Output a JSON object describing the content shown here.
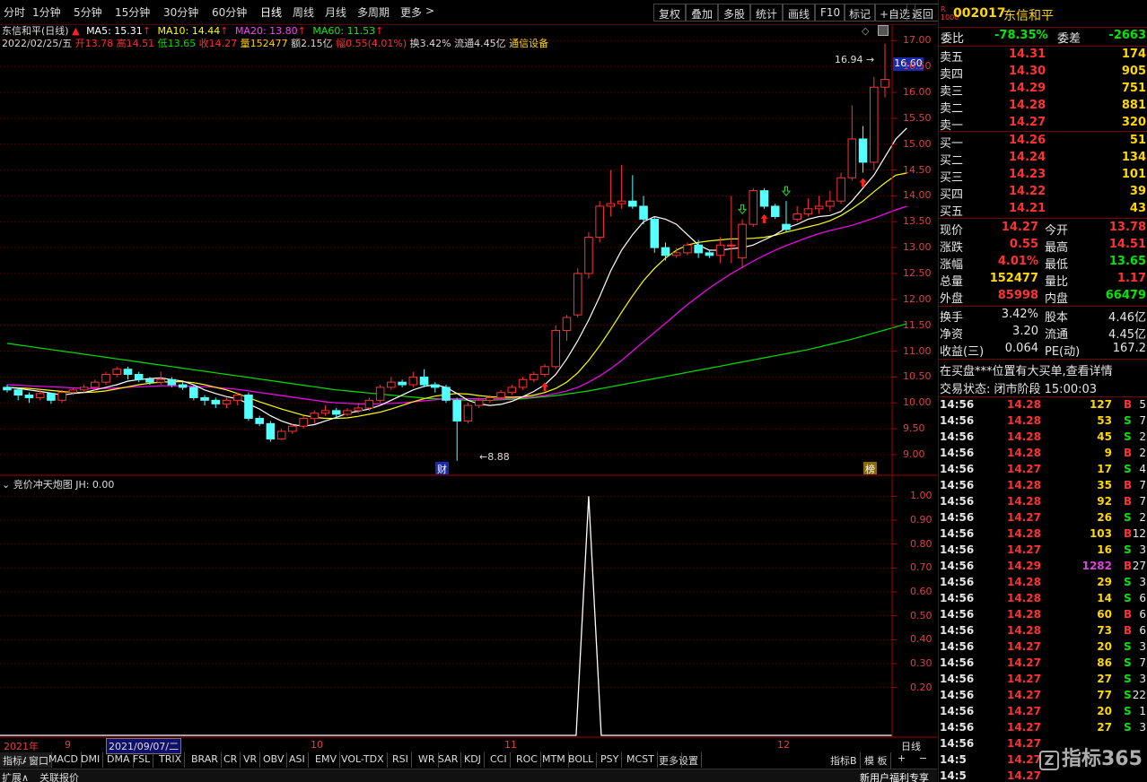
{
  "toolbar": {
    "periods": [
      "分时",
      "1分钟",
      "5分钟",
      "15分钟",
      "30分钟",
      "60分钟",
      "日线",
      "周线",
      "月线",
      "多周期",
      "更多"
    ],
    "buttons": [
      "复权",
      "叠加",
      "多股",
      "统计",
      "画线",
      "F10",
      "标记",
      "+自选",
      "返回"
    ]
  },
  "info": {
    "title": "东信和平(日线)",
    "ma5": "MA5: 15.31",
    "ma10": "MA10: 14.44",
    "ma20": "MA20: 13.80",
    "ma60": "MA60: 11.53",
    "date": "2022/02/25/五",
    "open": "开13.78",
    "high": "高14.51",
    "low": "低13.65",
    "close": "收14.27",
    "volume": "量152477",
    "amount": "额2.15亿",
    "amp": "幅0.55(4.01%)",
    "turnover": "换3.42%",
    "float": "流通4.45亿",
    "industry": "通信设备"
  },
  "chart_data": {
    "type": "candlestick",
    "ylim": [
      8.6,
      17.3
    ],
    "y_ticks": [
      "17.00",
      "16.50",
      "16.00",
      "15.50",
      "15.00",
      "14.50",
      "14.00",
      "13.50",
      "13.00",
      "12.50",
      "12.00",
      "11.50",
      "11.00",
      "10.50",
      "10.00",
      "9.50",
      "9.00"
    ],
    "y_values": [
      17,
      16.5,
      16,
      15.5,
      15,
      14.5,
      14,
      13.5,
      13,
      12.5,
      12,
      11.5,
      11,
      10.5,
      10,
      9.5,
      9
    ],
    "current_price": "16.60",
    "high_label": "16.94",
    "low_label": "8.88",
    "marker_cai": "财",
    "marker_bang": "榜",
    "candles": [
      [
        10.3,
        10.25,
        10.35,
        10.2
      ],
      [
        10.25,
        10.15,
        10.3,
        10.05
      ],
      [
        10.15,
        10.1,
        10.2,
        10.0
      ],
      [
        10.1,
        10.18,
        10.25,
        10.05
      ],
      [
        10.18,
        10.05,
        10.2,
        9.98
      ],
      [
        10.05,
        10.2,
        10.25,
        10.0
      ],
      [
        10.2,
        10.25,
        10.3,
        10.15
      ],
      [
        10.25,
        10.3,
        10.35,
        10.2
      ],
      [
        10.3,
        10.4,
        10.45,
        10.25
      ],
      [
        10.4,
        10.55,
        10.6,
        10.35
      ],
      [
        10.55,
        10.65,
        10.7,
        10.5
      ],
      [
        10.65,
        10.55,
        10.7,
        10.45
      ],
      [
        10.55,
        10.45,
        10.6,
        10.4
      ],
      [
        10.45,
        10.4,
        10.5,
        10.35
      ],
      [
        10.4,
        10.45,
        10.6,
        10.35
      ],
      [
        10.45,
        10.35,
        10.5,
        10.3
      ],
      [
        10.35,
        10.3,
        10.4,
        10.25
      ],
      [
        10.3,
        10.1,
        10.35,
        10.05
      ],
      [
        10.1,
        10.05,
        10.15,
        9.95
      ],
      [
        10.05,
        9.98,
        10.1,
        9.9
      ],
      [
        9.98,
        10.05,
        10.1,
        9.9
      ],
      [
        10.05,
        10.15,
        10.2,
        9.95
      ],
      [
        10.15,
        9.7,
        10.2,
        9.65
      ],
      [
        9.7,
        9.6,
        9.75,
        9.55
      ],
      [
        9.6,
        9.3,
        9.65,
        9.25
      ],
      [
        9.3,
        9.45,
        9.5,
        9.28
      ],
      [
        9.45,
        9.55,
        9.6,
        9.4
      ],
      [
        9.55,
        9.7,
        9.75,
        9.5
      ],
      [
        9.7,
        9.8,
        9.85,
        9.6
      ],
      [
        9.8,
        9.85,
        9.95,
        9.75
      ],
      [
        9.85,
        9.78,
        9.9,
        9.7
      ],
      [
        9.78,
        9.85,
        9.9,
        9.75
      ],
      [
        9.85,
        9.9,
        10.0,
        9.8
      ],
      [
        9.9,
        10.05,
        10.1,
        9.85
      ],
      [
        10.05,
        10.3,
        10.35,
        10.0
      ],
      [
        10.3,
        10.4,
        10.5,
        10.25
      ],
      [
        10.4,
        10.35,
        10.45,
        10.3
      ],
      [
        10.35,
        10.5,
        10.6,
        10.3
      ],
      [
        10.5,
        10.35,
        10.65,
        10.3
      ],
      [
        10.35,
        10.3,
        10.4,
        10.2
      ],
      [
        10.3,
        10.05,
        10.35,
        10.0
      ],
      [
        10.05,
        9.65,
        10.1,
        8.88
      ],
      [
        9.65,
        9.95,
        10.0,
        9.6
      ],
      [
        9.95,
        10.05,
        10.1,
        9.9
      ],
      [
        10.05,
        10.1,
        10.15,
        10.0
      ],
      [
        10.1,
        10.2,
        10.25,
        10.05
      ],
      [
        10.2,
        10.3,
        10.35,
        10.15
      ],
      [
        10.3,
        10.45,
        10.5,
        10.25
      ],
      [
        10.45,
        10.55,
        10.6,
        10.4
      ],
      [
        10.55,
        10.7,
        10.75,
        10.5
      ],
      [
        10.7,
        11.4,
        11.5,
        10.65
      ],
      [
        11.4,
        11.65,
        11.7,
        11.2
      ],
      [
        11.7,
        12.5,
        12.6,
        11.65
      ],
      [
        12.5,
        13.2,
        13.3,
        12.4
      ],
      [
        13.2,
        13.8,
        13.9,
        13.1
      ],
      [
        13.8,
        13.85,
        14.5,
        13.6
      ],
      [
        13.85,
        13.9,
        14.6,
        13.75
      ],
      [
        13.9,
        13.8,
        14.4,
        13.75
      ],
      [
        13.8,
        13.55,
        14.0,
        13.45
      ],
      [
        13.55,
        13.0,
        13.6,
        12.9
      ],
      [
        13.0,
        12.85,
        13.1,
        12.75
      ],
      [
        12.85,
        12.9,
        13.0,
        12.8
      ],
      [
        12.9,
        13.05,
        13.1,
        12.85
      ],
      [
        13.05,
        12.9,
        13.15,
        12.8
      ],
      [
        12.9,
        12.85,
        12.95,
        12.8
      ],
      [
        12.85,
        13.05,
        13.2,
        12.7
      ],
      [
        13.05,
        13.05,
        14.0,
        12.7
      ],
      [
        12.8,
        13.45,
        13.55,
        12.6
      ],
      [
        13.45,
        14.1,
        14.15,
        13.4
      ],
      [
        14.1,
        13.8,
        14.15,
        13.75
      ],
      [
        13.8,
        13.6,
        13.85,
        13.55
      ],
      [
        13.45,
        13.35,
        13.9,
        13.3
      ],
      [
        13.55,
        13.65,
        13.8,
        13.5
      ],
      [
        13.65,
        13.75,
        13.95,
        13.6
      ],
      [
        13.75,
        13.8,
        14.0,
        13.65
      ],
      [
        13.8,
        13.9,
        14.1,
        13.7
      ],
      [
        13.9,
        14.35,
        14.45,
        13.85
      ],
      [
        14.35,
        15.1,
        15.75,
        14.3
      ],
      [
        15.1,
        14.65,
        15.35,
        14.45
      ],
      [
        14.65,
        16.1,
        16.3,
        14.5
      ],
      [
        16.1,
        16.25,
        16.94,
        15.9
      ]
    ],
    "ma5": [
      10.3,
      10.28,
      10.25,
      10.22,
      10.19,
      10.15,
      10.18,
      10.2,
      10.25,
      10.3,
      10.35,
      10.42,
      10.45,
      10.47,
      10.48,
      10.45,
      10.42,
      10.35,
      10.25,
      10.18,
      10.12,
      10.08,
      9.98,
      9.88,
      9.75,
      9.65,
      9.58,
      9.55,
      9.58,
      9.65,
      9.72,
      9.8,
      9.84,
      9.88,
      9.95,
      10.05,
      10.15,
      10.25,
      10.32,
      10.35,
      10.3,
      10.18,
      10.05,
      9.98,
      9.95,
      9.97,
      10.03,
      10.12,
      10.22,
      10.35,
      10.55,
      10.85,
      11.2,
      11.6,
      12.05,
      12.55,
      12.95,
      13.25,
      13.5,
      13.6,
      13.55,
      13.45,
      13.25,
      13.05,
      12.95,
      12.95,
      12.98,
      13.0,
      13.05,
      13.15,
      13.25,
      13.38,
      13.45,
      13.55,
      13.6,
      13.62,
      13.7,
      13.9,
      14.15,
      14.4,
      14.75,
      15.1,
      15.31
    ],
    "ma10": [
      10.3,
      10.29,
      10.28,
      10.26,
      10.24,
      10.22,
      10.2,
      10.2,
      10.21,
      10.23,
      10.27,
      10.31,
      10.35,
      10.38,
      10.4,
      10.41,
      10.41,
      10.39,
      10.35,
      10.3,
      10.25,
      10.18,
      10.1,
      10.02,
      9.95,
      9.88,
      9.82,
      9.76,
      9.72,
      9.7,
      9.7,
      9.71,
      9.74,
      9.78,
      9.82,
      9.88,
      9.95,
      10.02,
      10.08,
      10.13,
      10.16,
      10.18,
      10.17,
      10.14,
      10.12,
      10.11,
      10.11,
      10.12,
      10.15,
      10.2,
      10.28,
      10.4,
      10.58,
      10.82,
      11.1,
      11.42,
      11.75,
      12.07,
      12.36,
      12.6,
      12.8,
      12.95,
      13.05,
      13.1,
      13.13,
      13.15,
      13.17,
      13.17,
      13.18,
      13.2,
      13.24,
      13.3,
      13.35,
      13.4,
      13.45,
      13.52,
      13.62,
      13.75,
      13.9,
      14.08,
      14.25,
      14.4,
      14.44
    ],
    "ma20": [
      10.35,
      10.34,
      10.33,
      10.32,
      10.31,
      10.3,
      10.29,
      10.28,
      10.28,
      10.28,
      10.29,
      10.3,
      10.31,
      10.32,
      10.33,
      10.33,
      10.33,
      10.32,
      10.31,
      10.3,
      10.28,
      10.26,
      10.23,
      10.2,
      10.17,
      10.14,
      10.11,
      10.08,
      10.05,
      10.02,
      10.0,
      9.99,
      9.98,
      9.98,
      9.98,
      9.99,
      10.0,
      10.02,
      10.04,
      10.06,
      10.08,
      10.08,
      10.08,
      10.08,
      10.08,
      10.08,
      10.09,
      10.1,
      10.12,
      10.14,
      10.18,
      10.23,
      10.3,
      10.4,
      10.52,
      10.66,
      10.82,
      11.0,
      11.18,
      11.36,
      11.54,
      11.72,
      11.9,
      12.06,
      12.22,
      12.36,
      12.5,
      12.62,
      12.74,
      12.85,
      12.95,
      13.04,
      13.12,
      13.2,
      13.27,
      13.33,
      13.38,
      13.43,
      13.5,
      13.57,
      13.65,
      13.73,
      13.8
    ],
    "ma60": [
      11.15,
      11.12,
      11.09,
      11.06,
      11.03,
      11.0,
      10.97,
      10.94,
      10.91,
      10.88,
      10.85,
      10.82,
      10.79,
      10.76,
      10.73,
      10.7,
      10.67,
      10.64,
      10.61,
      10.58,
      10.55,
      10.52,
      10.49,
      10.46,
      10.43,
      10.4,
      10.37,
      10.34,
      10.31,
      10.28,
      10.25,
      10.23,
      10.21,
      10.19,
      10.17,
      10.15,
      10.13,
      10.11,
      10.09,
      10.08,
      10.07,
      10.06,
      10.05,
      10.05,
      10.05,
      10.06,
      10.07,
      10.08,
      10.1,
      10.12,
      10.14,
      10.17,
      10.2,
      10.23,
      10.27,
      10.31,
      10.35,
      10.39,
      10.43,
      10.47,
      10.51,
      10.55,
      10.59,
      10.63,
      10.67,
      10.71,
      10.75,
      10.79,
      10.83,
      10.87,
      10.91,
      10.95,
      10.99,
      11.03,
      11.08,
      11.13,
      11.18,
      11.23,
      11.29,
      11.35,
      11.41,
      11.47,
      11.53
    ],
    "colors": {
      "up": "#ff3232",
      "down": "#54ffff",
      "ma5": "#ffffff",
      "ma10": "#ffff00",
      "ma20": "#ff00ff",
      "ma60": "#00e000"
    },
    "buy_markers": [
      49,
      69,
      78
    ],
    "sell_markers": [
      67,
      71
    ],
    "indicator": {
      "title": "竞价冲天炮图",
      "jh": "JH: 0.00",
      "ylim": [
        0,
        1.05
      ],
      "y_ticks": [
        "1.00",
        "0.90",
        "0.80",
        "0.70",
        "0.60",
        "0.50",
        "0.40",
        "0.30",
        "0.20"
      ],
      "y_values": [
        1.0,
        0.9,
        0.8,
        0.7,
        0.6,
        0.5,
        0.4,
        0.3,
        0.2
      ],
      "spike_index": 53
    }
  },
  "date_axis": {
    "year": "2021年",
    "m9": "9",
    "cursor": "2021/09/07/二",
    "m10": "10",
    "m11": "11",
    "m12": "12",
    "period": "日线"
  },
  "indicator_tabs": [
    "指标A",
    "窗口",
    "MACD",
    "DMI",
    "DMA",
    "FSL",
    "TRIX",
    "BRAR",
    "CR",
    "VR",
    "OBV",
    "ASI",
    "EMV",
    "VOL-TDX",
    "RSI",
    "WR",
    "SAR",
    "KDJ",
    "CCI",
    "ROC",
    "MTM",
    "BOLL",
    "PSY",
    "MCST",
    "更多",
    "设置"
  ],
  "bottom": {
    "expand": "扩展∧",
    "related": "关联报价",
    "indicator_b": "指标B",
    "template": "模 板",
    "plus": "+",
    "minus": "−",
    "promo": "新用户福利专享"
  },
  "quote": {
    "code": "002017",
    "name": "东信和平",
    "weibi_label": "委比",
    "weibi": "-78.35%",
    "weicha_label": "委差",
    "weicha": "-2663",
    "sells": [
      {
        "label": "卖五",
        "price": "14.31",
        "vol": "174"
      },
      {
        "label": "卖四",
        "price": "14.30",
        "vol": "905"
      },
      {
        "label": "卖三",
        "price": "14.29",
        "vol": "751"
      },
      {
        "label": "卖二",
        "price": "14.28",
        "vol": "881"
      },
      {
        "label": "卖一",
        "price": "14.27",
        "vol": "320"
      }
    ],
    "buys": [
      {
        "label": "买一",
        "price": "14.26",
        "vol": "51"
      },
      {
        "label": "买二",
        "price": "14.24",
        "vol": "134"
      },
      {
        "label": "买三",
        "price": "14.23",
        "vol": "101"
      },
      {
        "label": "买四",
        "price": "14.22",
        "vol": "39"
      },
      {
        "label": "买五",
        "price": "14.21",
        "vol": "43"
      }
    ],
    "stats": [
      {
        "l1": "现价",
        "v1": "14.27",
        "l2": "今开",
        "v2": "13.78",
        "c1": "red",
        "c2": "red"
      },
      {
        "l1": "涨跌",
        "v1": "0.55",
        "l2": "最高",
        "v2": "14.51",
        "c1": "red",
        "c2": "red"
      },
      {
        "l1": "涨幅",
        "v1": "4.01%",
        "l2": "最低",
        "v2": "13.65",
        "c1": "red",
        "c2": "green"
      },
      {
        "l1": "总量",
        "v1": "152477",
        "l2": "量比",
        "v2": "1.17",
        "c1": "yellow",
        "c2": "red"
      },
      {
        "l1": "外盘",
        "v1": "85998",
        "l2": "内盘",
        "v2": "66479",
        "c1": "red",
        "c2": "green"
      }
    ],
    "stats2": [
      {
        "l1": "换手",
        "v1": "3.42%",
        "l2": "股本",
        "v2": "4.46亿"
      },
      {
        "l1": "净资",
        "v1": "3.20",
        "l2": "流通",
        "v2": "4.45亿"
      },
      {
        "l1": "收益(三)",
        "v1": "0.064",
        "l2": "PE(动)",
        "v2": "167.2"
      }
    ],
    "notice": "在买盘***位置有大买单,查看详情",
    "trade_status": "交易状态: 闭市阶段 15:00:03",
    "ticks": [
      {
        "t": "14:56",
        "p": "14.28",
        "v": "127",
        "s": "B",
        "n": "5"
      },
      {
        "t": "14:56",
        "p": "14.28",
        "v": "53",
        "s": "S",
        "n": "7"
      },
      {
        "t": "14:56",
        "p": "14.28",
        "v": "45",
        "s": "S",
        "n": "2"
      },
      {
        "t": "14:56",
        "p": "14.28",
        "v": "9",
        "s": "B",
        "n": "2"
      },
      {
        "t": "14:56",
        "p": "14.27",
        "v": "17",
        "s": "S",
        "n": "4"
      },
      {
        "t": "14:56",
        "p": "14.28",
        "v": "35",
        "s": "B",
        "n": "7"
      },
      {
        "t": "14:56",
        "p": "14.28",
        "v": "92",
        "s": "B",
        "n": "7"
      },
      {
        "t": "14:56",
        "p": "14.27",
        "v": "26",
        "s": "S",
        "n": "2"
      },
      {
        "t": "14:56",
        "p": "14.28",
        "v": "103",
        "s": "B",
        "n": "12"
      },
      {
        "t": "14:56",
        "p": "14.27",
        "v": "16",
        "s": "S",
        "n": "3"
      },
      {
        "t": "14:56",
        "p": "14.29",
        "v": "1282",
        "s": "B",
        "n": "27"
      },
      {
        "t": "14:56",
        "p": "14.28",
        "v": "29",
        "s": "S",
        "n": "3"
      },
      {
        "t": "14:56",
        "p": "14.28",
        "v": "14",
        "s": "S",
        "n": "6"
      },
      {
        "t": "14:56",
        "p": "14.28",
        "v": "60",
        "s": "B",
        "n": "6"
      },
      {
        "t": "14:56",
        "p": "14.28",
        "v": "73",
        "s": "B",
        "n": "6"
      },
      {
        "t": "14:56",
        "p": "14.27",
        "v": "20",
        "s": "S",
        "n": "3"
      },
      {
        "t": "14:56",
        "p": "14.27",
        "v": "86",
        "s": "S",
        "n": "7"
      },
      {
        "t": "14:56",
        "p": "14.27",
        "v": "27",
        "s": "S",
        "n": "3"
      },
      {
        "t": "14:56",
        "p": "14.27",
        "v": "77",
        "s": "S",
        "n": "22"
      },
      {
        "t": "14:56",
        "p": "14.27",
        "v": "20",
        "s": "S",
        "n": "1"
      },
      {
        "t": "14:56",
        "p": "14.27",
        "v": "27",
        "s": "S",
        "n": "3"
      },
      {
        "t": "14:56",
        "p": "14.27",
        "v": "",
        "s": "",
        "n": ""
      },
      {
        "t": "14:5",
        "p": "14.27",
        "v": "",
        "s": "",
        "n": ""
      },
      {
        "t": "14:5",
        "p": "14.27",
        "v": "",
        "s": "",
        "n": ""
      }
    ]
  },
  "watermark": "指标365"
}
